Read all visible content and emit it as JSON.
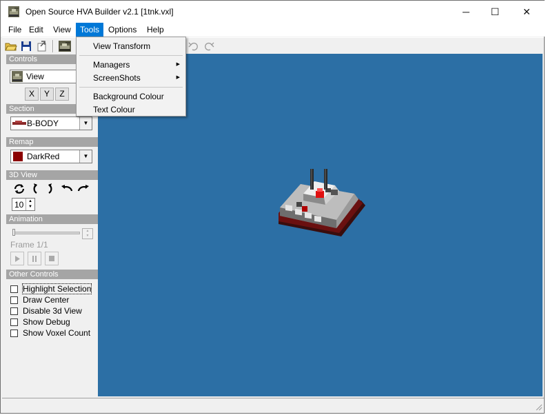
{
  "window": {
    "title": "Open Source HVA Builder v2.1 [1tnk.vxl]",
    "minimize_glyph": "─",
    "maximize_glyph": "☐",
    "close_glyph": "✕"
  },
  "menubar": {
    "items": [
      {
        "label": "File"
      },
      {
        "label": "Edit"
      },
      {
        "label": "View"
      },
      {
        "label": "Tools"
      },
      {
        "label": "Options"
      },
      {
        "label": "Help"
      }
    ],
    "active": "Tools"
  },
  "tools_menu": {
    "items": [
      {
        "label": "View Transform",
        "submenu": false
      },
      {
        "label": "Managers",
        "submenu": true
      },
      {
        "label": "ScreenShots",
        "submenu": true
      },
      {
        "label": "Background Colour",
        "submenu": false
      },
      {
        "label": "Text Colour",
        "submenu": false
      }
    ],
    "submenu_glyph": "▶"
  },
  "toolbar": {
    "icons": [
      "open-folder-icon",
      "save-icon",
      "export-icon",
      "tank-icon",
      "undo-icon",
      "redo-icon"
    ]
  },
  "controls": {
    "header": "Controls",
    "view_value": "View",
    "x_label": "X",
    "y_label": "Y",
    "z_label": "Z"
  },
  "section": {
    "header": "Section",
    "value": "B-BODY"
  },
  "remap": {
    "header": "Remap",
    "value": "DarkRed",
    "color": "#8b0000"
  },
  "view3d": {
    "header": "3D View",
    "spin_value": "10"
  },
  "animation": {
    "header": "Animation",
    "frame_label": "Frame 1/1"
  },
  "other_controls": {
    "header": "Other Controls",
    "items": [
      {
        "label": "Highlight Selection",
        "checked": false
      },
      {
        "label": "Draw Center",
        "checked": false
      },
      {
        "label": "Disable 3d View",
        "checked": false
      },
      {
        "label": "Show Debug",
        "checked": false
      },
      {
        "label": "Show Voxel Count",
        "checked": false
      }
    ]
  },
  "colors": {
    "viewport_bg": "#2c6fa5",
    "menu_active": "#0078d7",
    "section_header": "#a5a5a5"
  }
}
